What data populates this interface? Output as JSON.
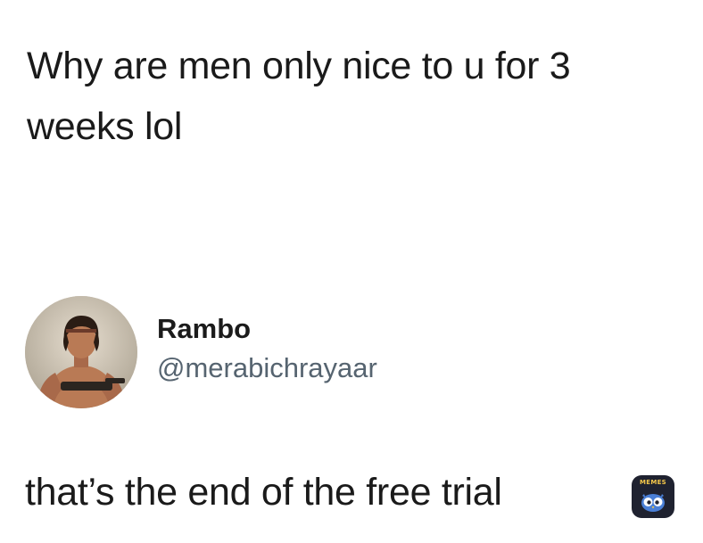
{
  "post": {
    "text": "Why are men only nice to u for 3 weeks lol"
  },
  "profile": {
    "display_name": "Rambo",
    "handle": "@merabichrayaar",
    "avatar_icon": "person-avatar-icon"
  },
  "reply": {
    "text": "that’s the end of the free trial"
  },
  "badge": {
    "label": "MEMES",
    "icon": "owl-icon",
    "background": "#1f2230",
    "label_color": "#f5c84a"
  },
  "colors": {
    "text": "#1a1a1a",
    "handle": "#566470",
    "background": "#ffffff"
  }
}
